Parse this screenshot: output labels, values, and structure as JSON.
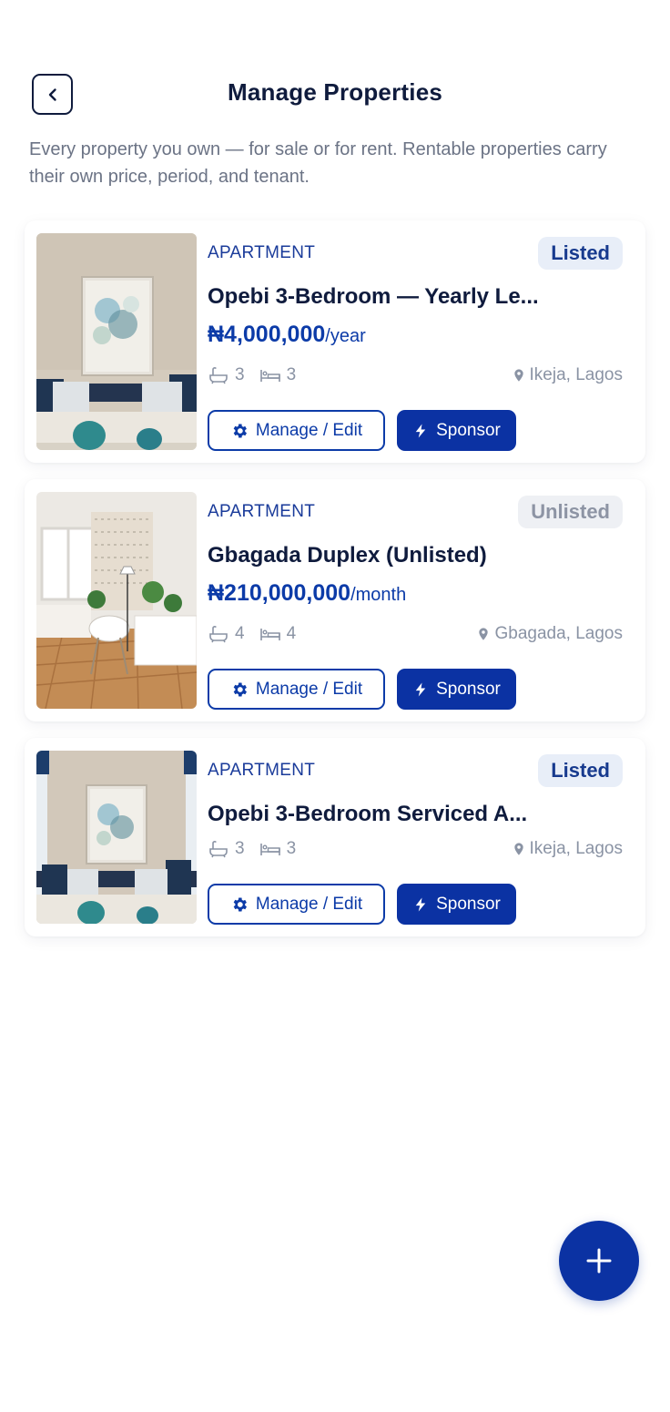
{
  "header": {
    "title": "Manage Properties",
    "subtitle": "Every property you own — for sale or for rent. Rentable properties carry their own price, period, and tenant."
  },
  "properties": [
    {
      "type": "APARTMENT",
      "status": "Listed",
      "name": "Opebi 3-Bedroom — Yearly Le...",
      "price": "₦4,000,000",
      "period": "/year",
      "baths": "3",
      "beds": "3",
      "location": "Ikeja, Lagos",
      "manage_label": "Manage / Edit",
      "sponsor_label": "Sponsor"
    },
    {
      "type": "APARTMENT",
      "status": "Unlisted",
      "name": "Gbagada Duplex (Unlisted)",
      "price": "₦210,000,000",
      "period": "/month",
      "baths": "4",
      "beds": "4",
      "location": "Gbagada, Lagos",
      "manage_label": "Manage / Edit",
      "sponsor_label": "Sponsor"
    },
    {
      "type": "APARTMENT",
      "status": "Listed",
      "name": "Opebi 3-Bedroom Serviced A...",
      "baths": "3",
      "beds": "3",
      "location": "Ikeja, Lagos",
      "manage_label": "Manage / Edit",
      "sponsor_label": "Sponsor"
    }
  ],
  "colors": {
    "primary": "#0b32a3",
    "listed_badge_bg": "#e8eef8",
    "unlisted_badge_bg": "#eef0f4",
    "muted_text": "#8a93a4"
  },
  "icons": {
    "back": "chevron-left-icon",
    "bath": "bathtub-icon",
    "bed": "bed-icon",
    "location": "map-pin-icon",
    "manage": "gear-icon",
    "sponsor": "lightning-icon",
    "fab": "plus-icon"
  }
}
